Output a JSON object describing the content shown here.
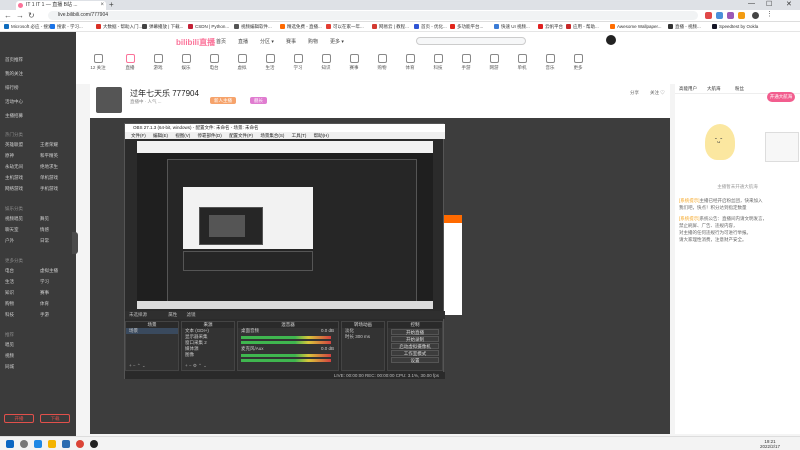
{
  "browser": {
    "tab_title": "IT 1 IT 1 — 直播 B站 ...",
    "new_tab": "+",
    "url": "live.bilibili.com/777904",
    "window_controls": [
      "—",
      "☐",
      "✕"
    ],
    "bookmarks": [
      {
        "label": "Microsoft 必应 - 搜索",
        "color": "#0f6cbd"
      },
      {
        "label": "搜索 - 学习...",
        "color": "#1a73e8"
      },
      {
        "label": "大数据 - 帮助入门...",
        "color": "#d93025"
      },
      {
        "label": "弹幕播放 | 下载...",
        "color": "#444444"
      },
      {
        "label": "CSDN | Python...",
        "color": "#c32136"
      },
      {
        "label": "视频编辑软件...",
        "color": "#555555"
      },
      {
        "label": "精选免费 - 直播...",
        "color": "#ff6a00"
      },
      {
        "label": "可以在家一年...",
        "color": "#e33e33"
      },
      {
        "label": "网易云 | 教程...",
        "color": "#d33a31"
      },
      {
        "label": "首页 - 优化...",
        "color": "#2f55d4"
      },
      {
        "label": "多功能平台...",
        "color": "#e1251b"
      },
      {
        "label": "快速 UI 视频...",
        "color": "#3a7bd5"
      },
      {
        "label": "云帆平台",
        "color": "#e02020"
      },
      {
        "label": "应用 - 帮助...",
        "color": "#c62828"
      },
      {
        "label": "Awesome Wallpaper...",
        "color": "#ff6d00"
      },
      {
        "label": "直播 - 视频...",
        "color": "#333333"
      },
      {
        "label": "Speedtest by Ookla",
        "color": "#141526"
      }
    ]
  },
  "site": {
    "logo": "bilibili直播",
    "nav": [
      "首页",
      "直播",
      "分区 ▾",
      "赛事",
      "购物",
      "更多 ▾"
    ],
    "entries": [
      "12 关注",
      "直播",
      "游戏",
      "娱乐",
      "电台",
      "虚拟",
      "生活",
      "学习",
      "知识",
      "赛事",
      "购物",
      "体育",
      "科技",
      "手游",
      "网游",
      "单机",
      "音乐",
      "更多"
    ]
  },
  "sidebar": {
    "items": [
      "首页推荐",
      "我的关注",
      "排行榜",
      "活动中心",
      "主播招募"
    ],
    "sections": [
      {
        "title": "热门分类",
        "items": [
          "英雄联盟",
          "王者荣耀",
          "原神",
          "和平精英",
          "永劫无间",
          "绝地求生",
          "主机游戏",
          "单机游戏",
          "网络游戏",
          "手机游戏"
        ]
      },
      {
        "title": "娱乐分类",
        "items": [
          "视频唱见",
          "舞见",
          "聊天室",
          "情感",
          "户外",
          "日常"
        ]
      },
      {
        "title": "更多分类",
        "items": [
          "电台",
          "虚拟主播",
          "生活",
          "学习",
          "知识",
          "赛事",
          "购物",
          "体育",
          "科技",
          "手游"
        ]
      },
      {
        "title": "推荐",
        "items": [
          "唱见",
          "视频",
          "同城"
        ]
      }
    ],
    "buttons": [
      "开播",
      "下载"
    ]
  },
  "streamer": {
    "title": "过年七天乐 777904",
    "meta": "直播中 · 人气 ...",
    "tag1": "新人主播",
    "tag2": "舰长",
    "actions": [
      "分享",
      "关注 ♡"
    ]
  },
  "right_panel": {
    "tabs": [
      "高能用户",
      "大航海",
      "粉丝"
    ],
    "badge": "开通大航海",
    "caption": "主播暂未开通大航海",
    "lines": [
      {
        "hl": "[系统提示]",
        "text": "主播已经开启粉丝团，快来加入"
      },
      {
        "hl": "",
        "text": "我们吧，快点！积分达到指定数量"
      },
      {
        "hl": "[系统提示]",
        "text": "系统公告：直播间内请文明发言，"
      },
      {
        "hl": "",
        "text": "禁止刷屏、广告、违规内容，"
      },
      {
        "hl": "",
        "text": "对主播的任何违规行为可进行举报。"
      },
      {
        "hl": "",
        "text": "请大家理性消费，注意财产安全。"
      }
    ]
  },
  "obs": {
    "title": "OBS 27.1.3 (64-bit, windows) - 配置文件: 未命名 - 场景: 未命名",
    "menu": [
      "文件(F)",
      "编辑(E)",
      "视图(V)",
      "停靠部件(D)",
      "配置文件(P)",
      "场景集合(S)",
      "工具(T)",
      "帮助(H)"
    ],
    "strip": [
      "未选择源",
      "属性",
      "滤镜"
    ],
    "docks": {
      "scenes": {
        "title": "场景",
        "items": [
          "场景"
        ]
      },
      "sources": {
        "title": "来源",
        "items": [
          "文本 (GDI+)",
          "显示器采集",
          "窗口采集 2",
          "媒体源",
          "图像"
        ]
      },
      "mixer": {
        "title": "混音器",
        "channels": [
          "桌面音频",
          "麦克风/Aux"
        ],
        "levels": [
          "0.0 dB",
          "0.0 dB"
        ]
      },
      "transitions": {
        "title": "转场动画",
        "type": "淡化",
        "duration_label": "时长",
        "duration": "300 ms"
      },
      "controls": {
        "title": "控制",
        "buttons": [
          "开始直播",
          "开始录制",
          "启动虚拟摄像机",
          "工作室模式",
          "设置",
          "退出"
        ]
      }
    },
    "status": "LIVE: 00:00:00   REC: 00:00:00   CPU: 3.1%, 30.00 fps"
  },
  "taskbar": {
    "time": "19:21",
    "date": "2022/2/17"
  },
  "colors": {
    "accent": "#fb7299",
    "sidebar": "#3b3b3b",
    "player": "#3d3d3d",
    "obs_bg": "#2b2b2b",
    "orange": "#ff6a00"
  }
}
